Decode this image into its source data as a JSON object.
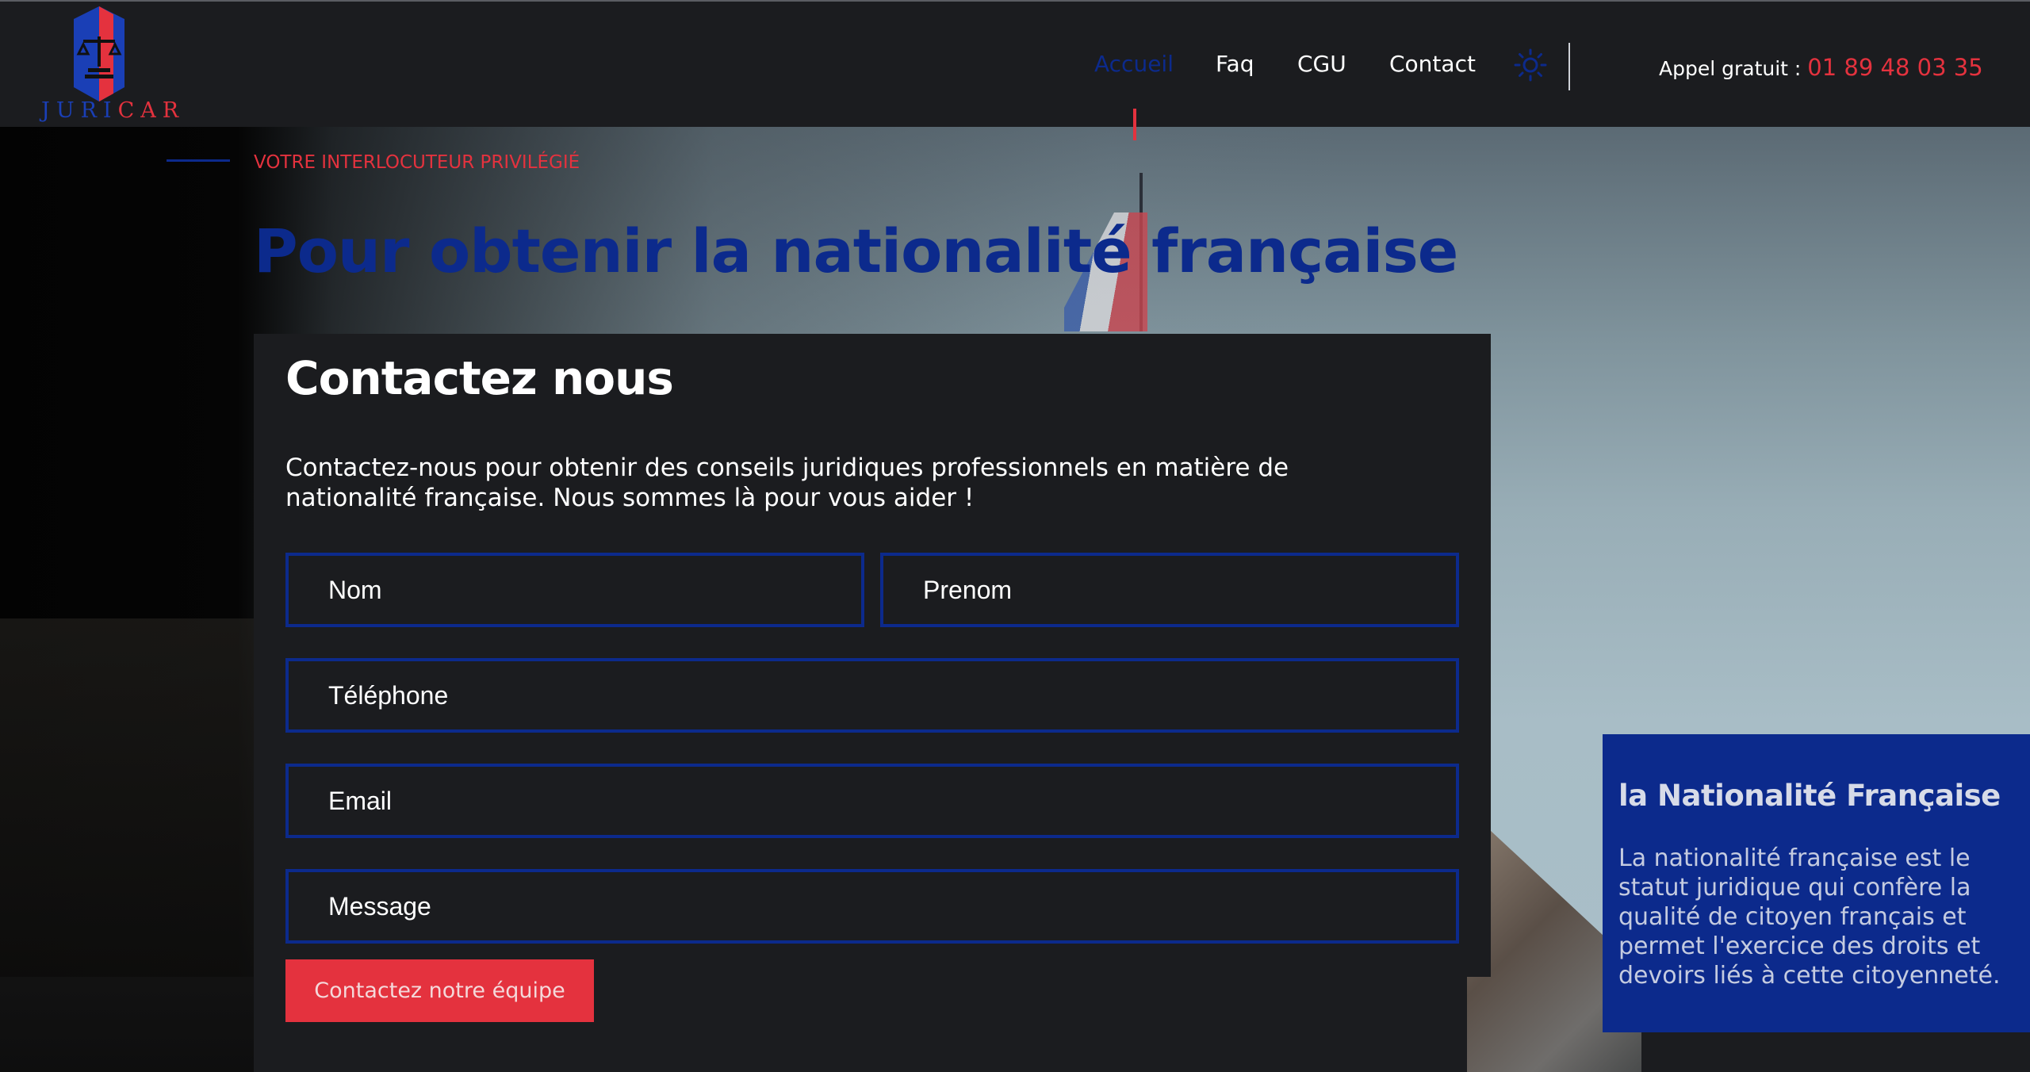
{
  "header": {
    "logo": {
      "part1": "JURI",
      "part2": "CAR"
    },
    "nav": [
      {
        "label": "Accueil",
        "active": true
      },
      {
        "label": "Faq",
        "active": false
      },
      {
        "label": "CGU",
        "active": false
      },
      {
        "label": "Contact",
        "active": false
      }
    ],
    "theme_toggle_icon": "sun-icon",
    "phone": {
      "label": "Appel gratuit : ",
      "number": "01 89 48 03 35"
    }
  },
  "hero": {
    "eyebrow": "VOTRE INTERLOCUTEUR PRIVILÉGIÉ",
    "title": "Pour obtenir la nationalité française"
  },
  "contact": {
    "title": "Contactez nous",
    "description": "Contactez-nous pour obtenir des conseils juridiques professionnels en matière de nationalité française. Nous sommes là pour vous aider !",
    "fields": {
      "nom": {
        "placeholder": "Nom",
        "value": ""
      },
      "prenom": {
        "placeholder": "Prenom",
        "value": ""
      },
      "telephone": {
        "placeholder": "Téléphone",
        "value": ""
      },
      "email": {
        "placeholder": "Email",
        "value": ""
      },
      "message": {
        "placeholder": "Message",
        "value": ""
      }
    },
    "submit_label": "Contactez notre équipe"
  },
  "info": {
    "title": "la Nationalité Française",
    "text": "La nationalité française est le statut juridique qui confère la qualité de citoyen français et permet l'exercice des droits et devoirs liés à cette citoyenneté."
  },
  "colors": {
    "background": "#1b1c1f",
    "primary_blue": "#0c2a8c",
    "accent_red": "#e4323e",
    "text": "#ffffff"
  }
}
